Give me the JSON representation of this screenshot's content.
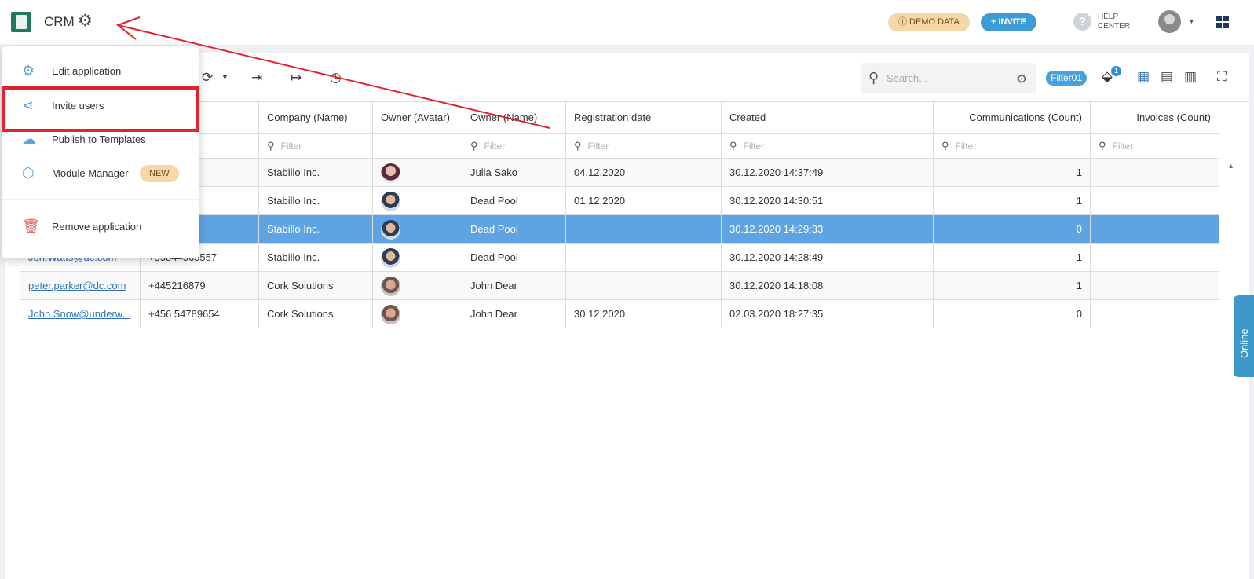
{
  "header": {
    "app_title": "CRM",
    "demo_label": "ⓘ DEMO DATA",
    "invite_label": "+ INVITE",
    "help_line1": "HELP",
    "help_line2": "CENTER"
  },
  "dropdown": {
    "items": [
      {
        "label": "Edit application",
        "icon": "gear-icon"
      },
      {
        "label": "Invite users",
        "icon": "share-icon"
      },
      {
        "label": "Publish to Templates",
        "icon": "cloud-upload-icon"
      },
      {
        "label": "Module Manager",
        "icon": "cube-icon",
        "badge": "NEW"
      },
      {
        "label": "Remove application",
        "icon": "trash-icon"
      }
    ]
  },
  "toolbar": {
    "search_placeholder": "Search...",
    "filter_badge": "Filter01",
    "tag_count": "1"
  },
  "table": {
    "columns": [
      "",
      "Phone number",
      "Company (Name)",
      "Owner (Avatar)",
      "Owner (Name)",
      "Registration date",
      "Created",
      "Communications (Count)",
      "Invoices (Count)"
    ],
    "header_partial": "mber",
    "filter_placeholder": "Filter",
    "rows": [
      {
        "email": "",
        "phone": "442",
        "company": "Stabillo Inc.",
        "avatar": "female",
        "owner": "Julia Sako",
        "registration": "04.12.2020",
        "created": "30.12.2020 14:37:49",
        "communications": "1",
        "invoices": ""
      },
      {
        "email": "",
        "phone": "74",
        "company": "Stabillo Inc.",
        "avatar": "male",
        "owner": "Dead Pool",
        "registration": "01.12.2020",
        "created": "30.12.2020 14:30:51",
        "communications": "1",
        "invoices": ""
      },
      {
        "email": "",
        "phone": "50420",
        "company": "Stabillo Inc.",
        "avatar": "male",
        "owner": "Dead Pool",
        "registration": "",
        "created": "30.12.2020 14:29:33",
        "communications": "0",
        "invoices": ""
      },
      {
        "email": "Jon.Watts@dc.com",
        "phone": "+55844565557",
        "company": "Stabillo Inc.",
        "avatar": "male",
        "owner": "Dead Pool",
        "registration": "",
        "created": "30.12.2020 14:28:49",
        "communications": "1",
        "invoices": ""
      },
      {
        "email": "peter.parker@dc.com",
        "phone": "+445216879",
        "company": "Cork Solutions",
        "avatar": "male2",
        "owner": "John Dear",
        "registration": "",
        "created": "30.12.2020 14:18:08",
        "communications": "1",
        "invoices": ""
      },
      {
        "email": "John.Snow@underw...",
        "phone": "+456 54789654",
        "company": "Cork Solutions",
        "avatar": "male2",
        "owner": "John Dear",
        "registration": "30.12.2020",
        "created": "02.03.2020 18:27:35",
        "communications": "0",
        "invoices": ""
      }
    ]
  },
  "online_tab": "Online",
  "colors": {
    "accent": "#3d9bd5",
    "selected_row": "#60a3e3",
    "highlight": "#e0242e",
    "demo_badge": "#f6d8a8"
  }
}
